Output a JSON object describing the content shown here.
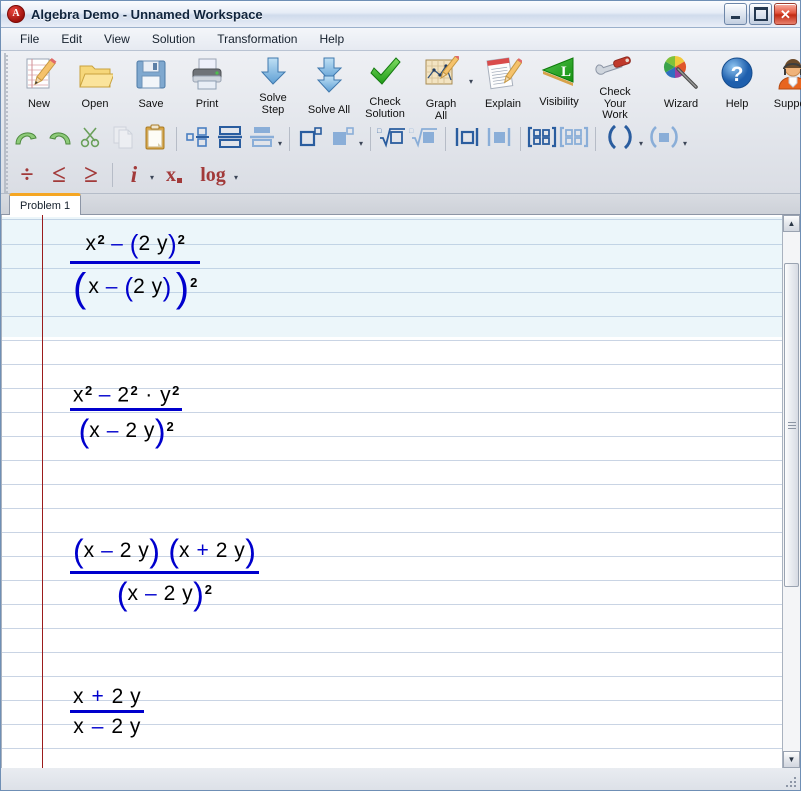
{
  "window": {
    "title": "Algebra Demo - Unnamed Workspace",
    "app_icon": "algebra-app-icon",
    "buttons": {
      "minimize": "minimize",
      "maximize": "maximize",
      "close": "close"
    }
  },
  "menubar": {
    "items": [
      {
        "label": "File"
      },
      {
        "label": "Edit"
      },
      {
        "label": "View"
      },
      {
        "label": "Solution"
      },
      {
        "label": "Transformation"
      },
      {
        "label": "Help"
      }
    ]
  },
  "toolbar_main": {
    "groups": [
      {
        "buttons": [
          {
            "label": "New",
            "icon": "new-document-pencil-icon"
          },
          {
            "label": "Open",
            "icon": "open-folder-icon"
          },
          {
            "label": "Save",
            "icon": "floppy-disk-icon"
          },
          {
            "label": "Print",
            "icon": "printer-icon"
          }
        ]
      },
      {
        "buttons": [
          {
            "label": "Solve\nStep",
            "icon": "down-arrow-icon"
          },
          {
            "label": "Solve All",
            "icon": "double-down-arrow-icon"
          },
          {
            "label": "Check\nSolution",
            "icon": "green-checkmark-icon"
          },
          {
            "label": "Graph All",
            "icon": "graph-plot-icon",
            "has_dropdown": true
          },
          {
            "label": "Explain",
            "icon": "explain-document-pencil-icon"
          },
          {
            "label": "Visibility",
            "icon": "green-triangle-l-icon"
          },
          {
            "label": "Check\nYour Work",
            "icon": "wrench-screwdriver-icon"
          }
        ]
      },
      {
        "buttons": [
          {
            "label": "Wizard",
            "icon": "magic-wand-color-wheel-icon"
          },
          {
            "label": "Help",
            "icon": "blue-question-mark-icon"
          },
          {
            "label": "Support",
            "icon": "support-headset-person-icon"
          }
        ]
      }
    ]
  },
  "toolbar_edit": {
    "groups": [
      {
        "buttons": [
          {
            "icon": "undo-arrow-icon",
            "enabled": true
          },
          {
            "icon": "redo-arrow-icon",
            "enabled": true
          },
          {
            "icon": "cut-scissors-icon",
            "enabled": true
          },
          {
            "icon": "copy-pages-icon",
            "enabled": false
          },
          {
            "icon": "paste-clipboard-icon",
            "enabled": true
          }
        ]
      },
      {
        "buttons": [
          {
            "icon": "fraction-small-icon"
          },
          {
            "icon": "fraction-medium-icon"
          },
          {
            "icon": "fraction-large-icon",
            "has_dropdown": true
          }
        ]
      },
      {
        "buttons": [
          {
            "icon": "exponent-empty-icon"
          },
          {
            "icon": "exponent-filled-icon",
            "has_dropdown": true
          }
        ]
      },
      {
        "buttons": [
          {
            "icon": "radical-empty-icon"
          },
          {
            "icon": "radical-filled-icon"
          }
        ]
      },
      {
        "buttons": [
          {
            "icon": "absolute-value-empty-icon"
          },
          {
            "icon": "absolute-value-filled-icon"
          }
        ]
      },
      {
        "buttons": [
          {
            "icon": "matrix-empty-icon"
          },
          {
            "icon": "matrix-filled-icon"
          }
        ]
      },
      {
        "buttons": [
          {
            "icon": "parentheses-empty-icon",
            "has_dropdown": true
          },
          {
            "icon": "parentheses-filled-icon",
            "has_dropdown": true
          }
        ]
      }
    ]
  },
  "toolbar_math": {
    "groups": [
      {
        "buttons": [
          {
            "icon": "divide-icon",
            "glyph": "÷"
          },
          {
            "icon": "less-than-or-equal-icon",
            "glyph": "≤"
          },
          {
            "icon": "greater-than-or-equal-icon",
            "glyph": "≥"
          }
        ]
      },
      {
        "buttons": [
          {
            "icon": "imaginary-unit-icon",
            "glyph": "i",
            "has_dropdown": true
          },
          {
            "icon": "subscript-x-icon",
            "glyph": "x"
          },
          {
            "icon": "logarithm-icon",
            "glyph": "log",
            "has_dropdown": true
          }
        ]
      }
    ]
  },
  "tabs": {
    "items": [
      {
        "label": "Problem 1",
        "active": true
      }
    ]
  },
  "worksheet": {
    "steps": [
      {
        "id": "step-1",
        "selected": true,
        "numerator": [
          {
            "text": "x",
            "style": "black"
          },
          {
            "text": "2",
            "style": "superscript"
          },
          {
            "text": "–",
            "style": "blue"
          },
          {
            "text": "(",
            "style": "paren"
          },
          {
            "text": "2 y",
            "style": "black"
          },
          {
            "text": ")",
            "style": "paren"
          },
          {
            "text": "2",
            "style": "superscript"
          }
        ],
        "denominator": [
          {
            "text": "(",
            "style": "paren-big"
          },
          {
            "text": "x",
            "style": "black"
          },
          {
            "text": "–",
            "style": "blue"
          },
          {
            "text": "(",
            "style": "paren"
          },
          {
            "text": "2 y",
            "style": "black"
          },
          {
            "text": ")",
            "style": "paren"
          },
          {
            "text": ")",
            "style": "paren-big"
          },
          {
            "text": "2",
            "style": "superscript"
          }
        ],
        "plain": "(x^2 - (2y)^2) / (x - (2y))^2"
      },
      {
        "id": "step-2",
        "selected": false,
        "numerator": [
          {
            "text": "x",
            "style": "black"
          },
          {
            "text": "2",
            "style": "superscript"
          },
          {
            "text": "–",
            "style": "blue"
          },
          {
            "text": "2",
            "style": "black"
          },
          {
            "text": "2",
            "style": "superscript"
          },
          {
            "text": "·",
            "style": "black"
          },
          {
            "text": "y",
            "style": "black"
          },
          {
            "text": "2",
            "style": "superscript"
          }
        ],
        "denominator": [
          {
            "text": "(",
            "style": "paren"
          },
          {
            "text": "x",
            "style": "black"
          },
          {
            "text": "–",
            "style": "blue"
          },
          {
            "text": "2 y",
            "style": "black"
          },
          {
            "text": ")",
            "style": "paren"
          },
          {
            "text": "2",
            "style": "superscript"
          }
        ],
        "plain": "(x^2 - 2^2 * y^2) / (x - 2y)^2"
      },
      {
        "id": "step-3",
        "selected": false,
        "numerator": [
          {
            "text": "(",
            "style": "paren"
          },
          {
            "text": "x",
            "style": "black"
          },
          {
            "text": "–",
            "style": "blue"
          },
          {
            "text": "2 y",
            "style": "black"
          },
          {
            "text": ")",
            "style": "paren"
          },
          {
            "text": "(",
            "style": "paren"
          },
          {
            "text": "x",
            "style": "black"
          },
          {
            "text": "+",
            "style": "blue"
          },
          {
            "text": "2 y",
            "style": "black"
          },
          {
            "text": ")",
            "style": "paren"
          }
        ],
        "denominator": [
          {
            "text": "(",
            "style": "paren"
          },
          {
            "text": "x",
            "style": "black"
          },
          {
            "text": "–",
            "style": "blue"
          },
          {
            "text": "2 y",
            "style": "black"
          },
          {
            "text": ")",
            "style": "paren"
          },
          {
            "text": "2",
            "style": "superscript"
          }
        ],
        "plain": "((x - 2y)(x + 2y)) / (x - 2y)^2"
      },
      {
        "id": "step-4",
        "selected": false,
        "numerator": [
          {
            "text": "x",
            "style": "black"
          },
          {
            "text": "+",
            "style": "blue"
          },
          {
            "text": "2 y",
            "style": "black"
          }
        ],
        "denominator": [
          {
            "text": "x",
            "style": "black"
          },
          {
            "text": "–",
            "style": "blue"
          },
          {
            "text": "2 y",
            "style": "black"
          }
        ],
        "plain": "(x + 2y) / (x - 2y)"
      }
    ]
  },
  "scrollbar": {
    "up_glyph": "▲",
    "down_glyph": "▼",
    "thumb_top_pct": 6,
    "thumb_height_pct": 62
  },
  "colors": {
    "expression_blue": "#0000cd",
    "margin_red": "#9b1c1c",
    "selection_blue": "#e9f3f8",
    "tab_accent": "#f5a623",
    "math_op_red": "#a23a3a"
  }
}
